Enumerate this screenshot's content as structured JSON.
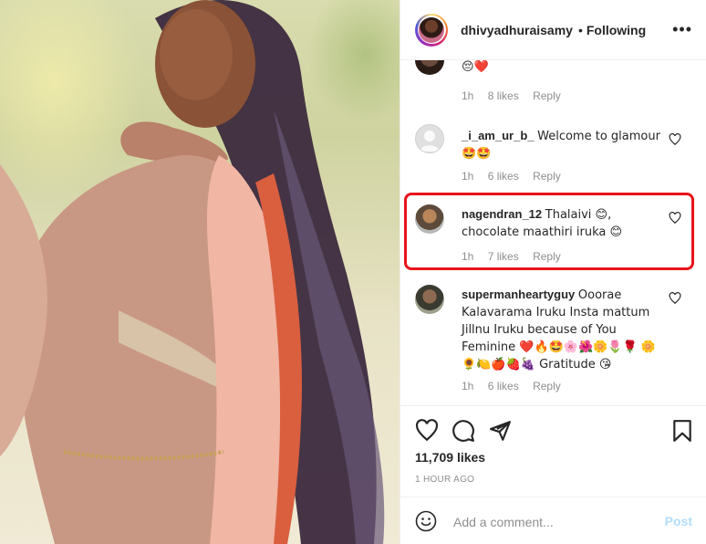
{
  "header": {
    "username": "dhivyadhuraisamy",
    "separator": "•",
    "follow_status": "Following",
    "more_label": "•••"
  },
  "comments": [
    {
      "username": "",
      "text": "😔❤️",
      "time": "1h",
      "likes": "8 likes",
      "reply": "Reply"
    },
    {
      "username": "_i_am_ur_b_",
      "text": "Welcome to glamour 🤩🤩",
      "time": "1h",
      "likes": "6 likes",
      "reply": "Reply"
    },
    {
      "username": "nagendran_12",
      "text": "Thalaivi 😊, chocolate maathiri iruka 😊",
      "time": "1h",
      "likes": "7 likes",
      "reply": "Reply"
    },
    {
      "username": "supermanheartyguy",
      "text": "Ooorae Kalavarama Iruku Insta mattum Jillnu Iruku because of You Feminine ❤️🔥🤩🌸🌺🌼🌷🌹 🌼🌻🍋🍎🍓🍇 Gratitude 😘",
      "time": "1h",
      "likes": "6 likes",
      "reply": "Reply"
    }
  ],
  "actions": {
    "likes_count": "11,709 likes",
    "time_ago": "1 HOUR AGO"
  },
  "add_comment": {
    "placeholder": "Add a comment...",
    "post_label": "Post"
  },
  "colors": {
    "highlight": "#e8141b",
    "post_disabled": "#b2dffc",
    "secondary_text": "#8e8e8e"
  }
}
